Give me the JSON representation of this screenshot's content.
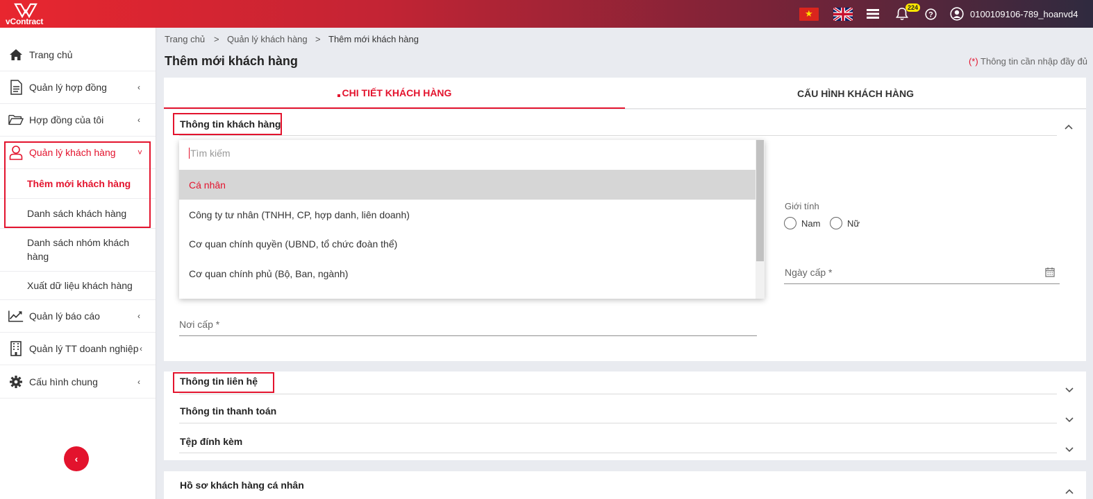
{
  "app": {
    "logo_text": "vContract"
  },
  "topbar": {
    "notif_count": "224",
    "user": "0100109106-789_hoanvd4",
    "icons": [
      "flag-vn-icon",
      "flag-uk-icon",
      "menu-icon",
      "bell-icon",
      "help-icon",
      "user-circle-icon"
    ]
  },
  "sidebar": {
    "items": [
      {
        "label": "Trang chủ",
        "icon": "home-icon"
      },
      {
        "label": "Quản lý hợp đồng",
        "icon": "document-icon"
      },
      {
        "label": "Hợp đồng của tôi",
        "icon": "folder-icon"
      },
      {
        "label": "Quản lý khách hàng",
        "icon": "user-icon"
      },
      {
        "label": "Quản lý báo cáo",
        "icon": "chart-icon"
      },
      {
        "label": "Quản lý TT doanh nghiệp",
        "icon": "building-icon"
      },
      {
        "label": "Cấu hình chung",
        "icon": "gear-icon"
      }
    ],
    "subitems": [
      {
        "label": "Thêm mới khách hàng"
      },
      {
        "label": "Danh sách khách hàng"
      },
      {
        "label": "Danh sách nhóm khách hàng"
      },
      {
        "label": "Xuất dữ liệu khách hàng"
      }
    ],
    "collapse_glyph": "‹",
    "chevron_left": "‹",
    "chevron_down": "˅"
  },
  "breadcrumb": {
    "home": "Trang chủ",
    "sep": ">",
    "parent": "Quản lý khách hàng",
    "current": "Thêm mới khách hàng"
  },
  "page": {
    "title": "Thêm mới khách hàng",
    "required_mark": "(*)",
    "required_text": " Thông tin cần nhập đầy đủ"
  },
  "tabs": {
    "active": "CHI TIẾT KHÁCH HÀNG",
    "inactive": "CẤU HÌNH KHÁCH HÀNG"
  },
  "sections": {
    "customer_info": "Thông tin khách hàng",
    "contact_info": "Thông tin liên hệ",
    "payment_info": "Thông tin thanh toán",
    "attachments": "Tệp đính kèm",
    "profile": "Hồ sơ khách hàng cá nhân"
  },
  "dropdown": {
    "search_placeholder": "Tìm kiếm",
    "options": [
      "Cá nhân",
      "Công ty tư nhân (TNHH, CP, hợp danh, liên doanh)",
      "Cơ quan chính quyền (UBND, tổ chức đoàn thể)",
      "Cơ quan chính phủ (Bộ, Ban, ngành)"
    ],
    "selected_index": 0
  },
  "form": {
    "gender_label": "Giới tính",
    "gender_male": "Nam",
    "gender_female": "Nữ",
    "issue_date_label": "Ngày cấp *",
    "issue_place_label": "Nơi cấp *"
  },
  "colors": {
    "accent": "#e3132d",
    "bg": "#e9ebf0"
  }
}
